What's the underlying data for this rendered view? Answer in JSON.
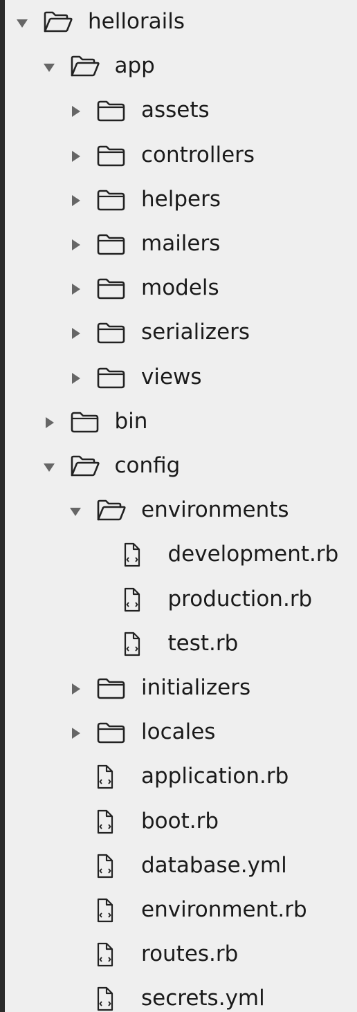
{
  "project_navigator": {
    "colors": {
      "background": "#efefef",
      "frame": "#2b2b2b",
      "text": "#1a1a1a",
      "icon": "#222222",
      "disclosure": "#666666"
    },
    "items": [
      {
        "label": "hellorails",
        "kind": "folder",
        "depth": 0,
        "state": "expanded"
      },
      {
        "label": "app",
        "kind": "folder",
        "depth": 1,
        "state": "expanded"
      },
      {
        "label": "assets",
        "kind": "folder",
        "depth": 2,
        "state": "collapsed"
      },
      {
        "label": "controllers",
        "kind": "folder",
        "depth": 2,
        "state": "collapsed"
      },
      {
        "label": "helpers",
        "kind": "folder",
        "depth": 2,
        "state": "collapsed"
      },
      {
        "label": "mailers",
        "kind": "folder",
        "depth": 2,
        "state": "collapsed"
      },
      {
        "label": "models",
        "kind": "folder",
        "depth": 2,
        "state": "collapsed"
      },
      {
        "label": "serializers",
        "kind": "folder",
        "depth": 2,
        "state": "collapsed"
      },
      {
        "label": "views",
        "kind": "folder",
        "depth": 2,
        "state": "collapsed"
      },
      {
        "label": "bin",
        "kind": "folder",
        "depth": 1,
        "state": "collapsed"
      },
      {
        "label": "config",
        "kind": "folder",
        "depth": 1,
        "state": "expanded"
      },
      {
        "label": "environments",
        "kind": "folder",
        "depth": 2,
        "state": "expanded"
      },
      {
        "label": "development.rb",
        "kind": "file",
        "depth": 3
      },
      {
        "label": "production.rb",
        "kind": "file",
        "depth": 3
      },
      {
        "label": "test.rb",
        "kind": "file",
        "depth": 3
      },
      {
        "label": "initializers",
        "kind": "folder",
        "depth": 2,
        "state": "collapsed"
      },
      {
        "label": "locales",
        "kind": "folder",
        "depth": 2,
        "state": "collapsed"
      },
      {
        "label": "application.rb",
        "kind": "file",
        "depth": 2
      },
      {
        "label": "boot.rb",
        "kind": "file",
        "depth": 2
      },
      {
        "label": "database.yml",
        "kind": "file",
        "depth": 2
      },
      {
        "label": "environment.rb",
        "kind": "file",
        "depth": 2
      },
      {
        "label": "routes.rb",
        "kind": "file",
        "depth": 2
      },
      {
        "label": "secrets.yml",
        "kind": "file",
        "depth": 2
      }
    ]
  }
}
